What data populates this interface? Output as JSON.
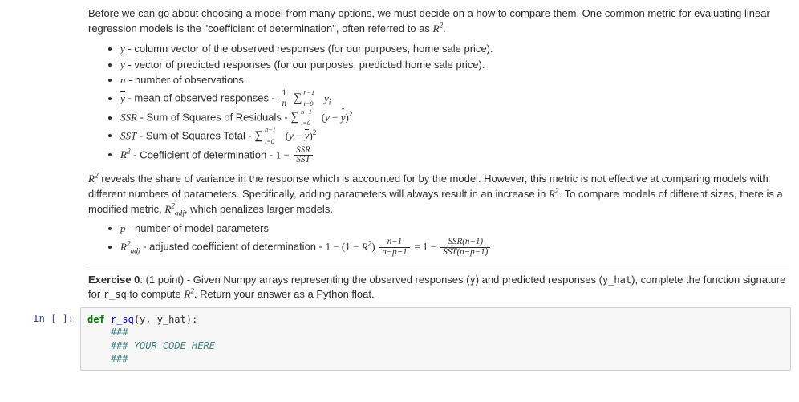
{
  "intro": {
    "p1_a": "Before we can go about choosing a model from many options, we must decide on a how to compare them. One common metric for evaluating linear regression models is the \"coefficient of determination\", often referred to as ",
    "p1_b": "."
  },
  "defs": {
    "y": " - column vector of the observed responses (for our purposes, home sale price).",
    "yhat": " - vector of predicted responses (for our purposes, predicted home sale price).",
    "n": " - number of observations.",
    "ybar": " - mean of observed responses - ",
    "ssr": " - Sum of Squares of Residuals - ",
    "sst": " - Sum of Squares Total - ",
    "r2": " - Coefficient of determination - "
  },
  "mid": {
    "p_a": " reveals the share of variance in the response which is accounted for by the model. However, this metric is not effective at comparing models with different numbers of parameters. Specifically, adding parameters will always result in an increase in ",
    "p_b": ". To compare models of different sizes, there is a modified metric, ",
    "p_c": ", which penalizes larger models."
  },
  "defs2": {
    "p": " - number of model parameters",
    "r2adj": " - adjusted coefficient of determination - "
  },
  "exercise": {
    "lead": "Exercise 0",
    "pts": ": (1 point) - Given Numpy arrays representing the observed responses (",
    "y": "y",
    "mid1": ") and predicted responses (",
    "yhat": "y_hat",
    "mid2": "), complete the function signature for ",
    "fn": "r_sq",
    "mid3": " to compute ",
    "tail": ". Return your answer as a Python float."
  },
  "code": {
    "prompt": "In [ ]:",
    "kw_def": "def",
    "fn_name": "r_sq",
    "args": "(y, y_hat):",
    "c1": "###",
    "c2": "### YOUR CODE HERE",
    "c3": "###"
  },
  "sym": {
    "y": "y",
    "yhat": "y",
    "n": "n",
    "ybar": "y",
    "ssr": "SSR",
    "sst": "SST",
    "R": "R",
    "adj": "adj",
    "p": "p",
    "one": "1",
    "eq": " = ",
    "minus": " − ",
    "lpar": "(",
    "rpar": ")",
    "sq": "2",
    "sum_up": "n−1",
    "sum_lo": "i=0",
    "yi": "y",
    "i": "i",
    "frac_1": "1",
    "frac_n": "n",
    "nm1": "n−1",
    "npm1": "n−p−1",
    "ssr_n1": "SSR(n−1)",
    "sst_np1": "SST(n−p−1)"
  }
}
